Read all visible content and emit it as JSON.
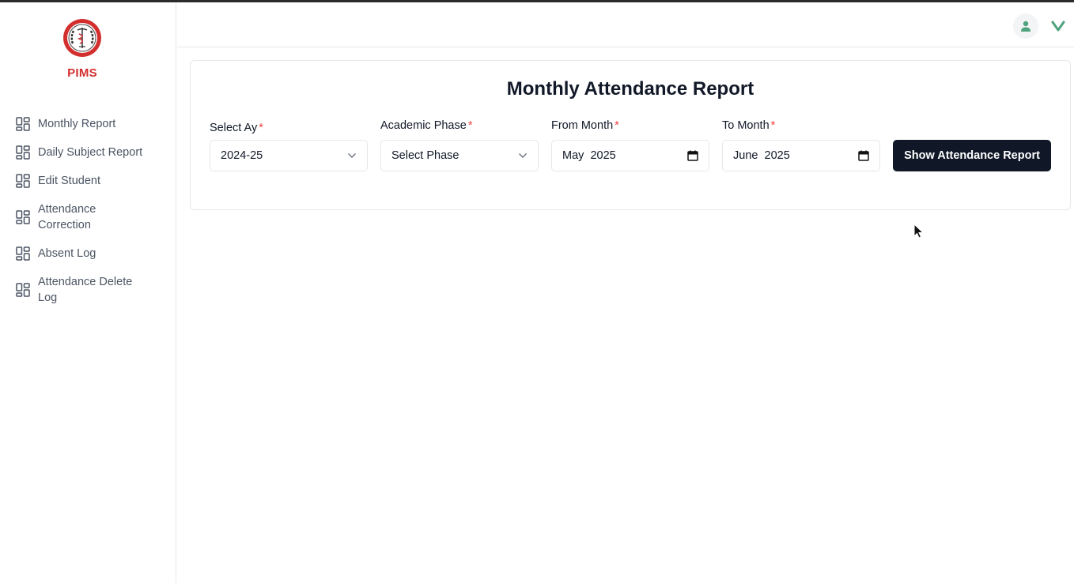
{
  "app": {
    "brand": "PIMS",
    "colors": {
      "brand": "#d32f2f",
      "primary_button": "#101828",
      "required": "#ef4444",
      "accent_green": "#4fa37f"
    }
  },
  "sidebar": {
    "items": [
      {
        "label": "Monthly Report",
        "icon": "grid-icon"
      },
      {
        "label": "Daily Subject Report",
        "icon": "grid-icon"
      },
      {
        "label": "Edit Student",
        "icon": "grid-icon"
      },
      {
        "label": "Attendance Correction",
        "icon": "grid-icon"
      },
      {
        "label": "Absent Log",
        "icon": "grid-icon"
      },
      {
        "label": "Attendance Delete Log",
        "icon": "grid-icon"
      }
    ]
  },
  "header": {
    "avatar_icon": "user-icon",
    "menu_icon": "chevron-down-icon"
  },
  "report": {
    "title": "Monthly Attendance Report",
    "required_mark": "*",
    "fields": {
      "ay": {
        "label": "Select Ay",
        "value": "2024-25"
      },
      "phase": {
        "label": "Academic Phase",
        "value": "Select Phase"
      },
      "from_month": {
        "label": "From Month",
        "value": "May  2025"
      },
      "to_month": {
        "label": "To Month",
        "value": "June  2025"
      }
    },
    "submit_label": "Show Attendance Report"
  }
}
